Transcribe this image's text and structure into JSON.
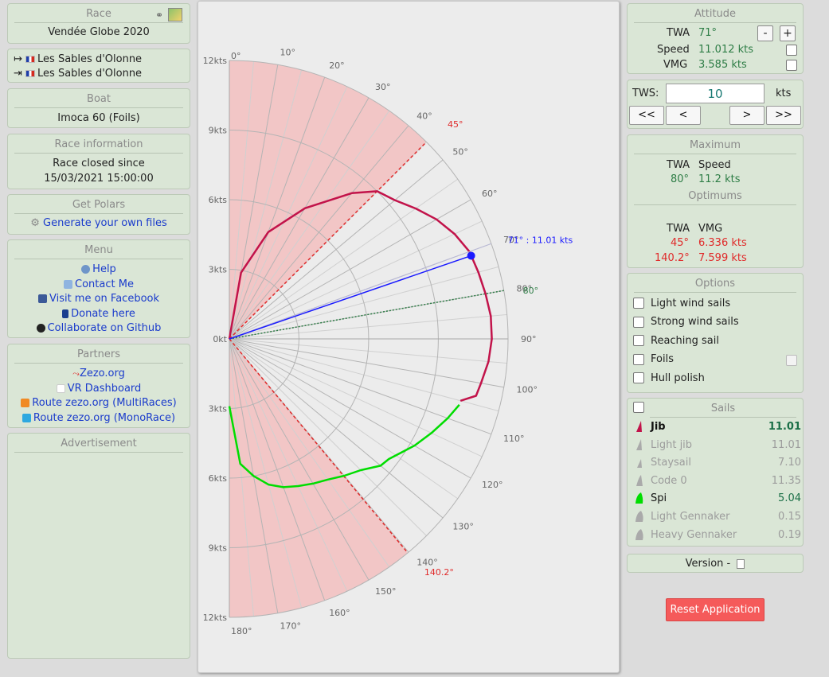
{
  "race": {
    "title": "Race",
    "name": "Vendée Globe 2020",
    "start": "Les Sables d'Olonne",
    "finish": "Les Sables d'Olonne",
    "start_marker": "↦",
    "finish_marker": "⇥"
  },
  "boat": {
    "title": "Boat",
    "name": "Imoca 60 (Foils)"
  },
  "race_info": {
    "title": "Race information",
    "status": "Race closed since",
    "date": "15/03/2021 15:00:00"
  },
  "polars": {
    "title": "Get Polars",
    "link": "Generate your own files"
  },
  "menu": {
    "title": "Menu",
    "items": [
      "Help",
      "Contact Me",
      "Visit me on Facebook",
      "Donate here",
      "Collaborate on Github"
    ]
  },
  "partners": {
    "title": "Partners",
    "items": [
      "Zezo.org",
      "VR Dashboard",
      "Route zezo.org (MultiRaces)",
      "Route zezo.org (MonoRace)"
    ]
  },
  "advertisement": {
    "title": "Advertisement"
  },
  "attitude": {
    "title": "Attitude",
    "twa_label": "TWA",
    "twa_value": "71°",
    "speed_label": "Speed",
    "speed_value": "11.012 kts",
    "vmg_label": "VMG",
    "vmg_value": "3.585 kts",
    "minus": "-",
    "plus": "+"
  },
  "tws": {
    "label": "TWS:",
    "value": "10",
    "unit": "kts",
    "buttons": [
      "<<",
      "<",
      ">",
      ">>"
    ]
  },
  "maximum": {
    "title": "Maximum",
    "twa_label": "TWA",
    "speed_label": "Speed",
    "twa": "80°",
    "speed": "11.2 kts"
  },
  "optimums": {
    "title": "Optimums",
    "twa_label": "TWA",
    "vmg_label": "VMG",
    "rows": [
      {
        "twa": "45°",
        "vmg": "6.336 kts"
      },
      {
        "twa": "140.2°",
        "vmg": "7.599 kts"
      }
    ]
  },
  "options": {
    "title": "Options",
    "items": [
      "Light wind sails",
      "Strong wind sails",
      "Reaching sail",
      "Foils",
      "Hull polish"
    ]
  },
  "sails": {
    "title": "Sails",
    "items": [
      {
        "name": "Jib",
        "value": "11.01",
        "color": "#c2134a",
        "active": true
      },
      {
        "name": "Light jib",
        "value": "11.01",
        "color": "#aaaaaa",
        "active": false
      },
      {
        "name": "Staysail",
        "value": "7.10",
        "color": "#aaaaaa",
        "active": false
      },
      {
        "name": "Code 0",
        "value": "11.35",
        "color": "#aaaaaa",
        "active": false
      },
      {
        "name": "Spi",
        "value": "5.04",
        "color": "#00dd00",
        "active": true
      },
      {
        "name": "Light Gennaker",
        "value": "0.15",
        "color": "#aaaaaa",
        "active": false
      },
      {
        "name": "Heavy Gennaker",
        "value": "0.19",
        "color": "#aaaaaa",
        "active": false
      }
    ]
  },
  "version": {
    "label": "Version -"
  },
  "reset_label": "Reset Application",
  "colors": {
    "panel_bg": "#dae6d6",
    "jib": "#c2134a",
    "spi": "#00dd00",
    "cursor": "#1a1aff",
    "dead_zone": "#f2c6c6",
    "optimum": "#e02a2a",
    "max_speed": "#2e7d46"
  },
  "chart_data": {
    "type": "polar",
    "angle_labels": [
      "0°",
      "10°",
      "20°",
      "30°",
      "40°",
      "50°",
      "60°",
      "70°",
      "80°",
      "90°",
      "100°",
      "110°",
      "120°",
      "130°",
      "140°",
      "150°",
      "160°",
      "170°",
      "180°"
    ],
    "radius_labels": [
      "0kt",
      "3kts",
      "6kts",
      "9kts",
      "12kts"
    ],
    "rmax": 12,
    "dead_zones": [
      [
        0,
        45
      ],
      [
        140.2,
        180
      ]
    ],
    "optimum_lines": [
      {
        "twa": 45,
        "label": "45°"
      },
      {
        "twa": 140.2,
        "label": "140.2°"
      }
    ],
    "max_speed_line": {
      "twa": 80,
      "label": "80°"
    },
    "cursor": {
      "twa": 71,
      "speed": 11.01,
      "label": "71° : 11.01 kts"
    },
    "series": [
      {
        "name": "Jib",
        "color": "#c2134a",
        "points": [
          [
            0,
            0
          ],
          [
            10,
            2.9
          ],
          [
            20,
            4.9
          ],
          [
            30,
            6.5
          ],
          [
            40,
            8.2
          ],
          [
            45,
            9.0
          ],
          [
            50,
            9.3
          ],
          [
            55,
            9.8
          ],
          [
            60,
            10.3
          ],
          [
            65,
            10.7
          ],
          [
            70,
            11.0
          ],
          [
            75,
            11.1
          ],
          [
            80,
            11.2
          ],
          [
            85,
            11.3
          ],
          [
            90,
            11.3
          ],
          [
            95,
            11.2
          ],
          [
            100,
            11.0
          ],
          [
            103,
            10.9
          ],
          [
            105,
            10.3
          ]
        ]
      },
      {
        "name": "Spi",
        "color": "#00dd00",
        "points": [
          [
            106,
            10.3
          ],
          [
            110,
            10.0
          ],
          [
            115,
            9.6
          ],
          [
            120,
            9.2
          ],
          [
            127,
            8.6
          ],
          [
            130,
            8.5
          ],
          [
            135,
            8.0
          ],
          [
            140,
            7.7
          ],
          [
            145,
            7.4
          ],
          [
            150,
            7.2
          ],
          [
            155,
            7.0
          ],
          [
            160,
            6.8
          ],
          [
            165,
            6.5
          ],
          [
            170,
            6.0
          ],
          [
            175,
            5.4
          ],
          [
            180,
            2.9
          ]
        ]
      }
    ]
  }
}
